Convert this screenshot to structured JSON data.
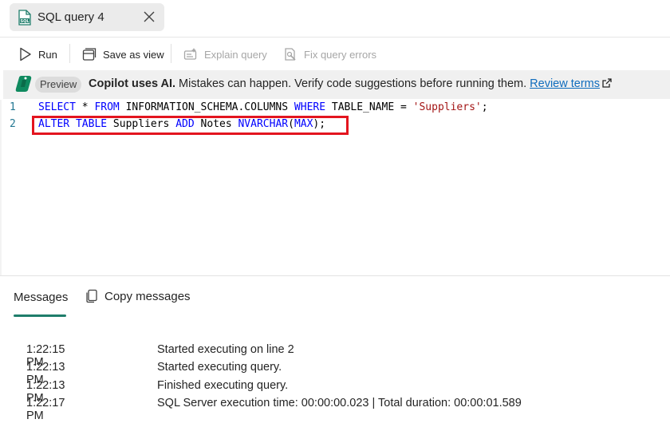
{
  "tab": {
    "title": "SQL query 4",
    "icon": "sql-file-icon"
  },
  "toolbar": {
    "run": "Run",
    "save_as_view": "Save as view",
    "explain_query": "Explain query",
    "fix_query_errors": "Fix query errors"
  },
  "banner": {
    "badge": "Preview",
    "bold": "Copilot uses AI.",
    "message": " Mistakes can happen. Verify code suggestions before running them. ",
    "link": "Review terms"
  },
  "editor": {
    "lines": [
      {
        "number": "1",
        "tokens": [
          {
            "t": "SELECT",
            "c": "kw"
          },
          {
            "t": " * ",
            "c": "tx"
          },
          {
            "t": "FROM",
            "c": "kw"
          },
          {
            "t": " INFORMATION_SCHEMA.COLUMNS ",
            "c": "tx"
          },
          {
            "t": "WHERE",
            "c": "kw"
          },
          {
            "t": " TABLE_NAME = ",
            "c": "tx"
          },
          {
            "t": "'Suppliers'",
            "c": "str"
          },
          {
            "t": ";",
            "c": "tx"
          }
        ]
      },
      {
        "number": "2",
        "tokens": [
          {
            "t": "ALTER",
            "c": "kw"
          },
          {
            "t": " ",
            "c": "tx"
          },
          {
            "t": "TABLE",
            "c": "kw"
          },
          {
            "t": " Suppliers ",
            "c": "tx"
          },
          {
            "t": "ADD",
            "c": "kw"
          },
          {
            "t": " Notes ",
            "c": "tx"
          },
          {
            "t": "NVARCHAR",
            "c": "kw"
          },
          {
            "t": "(",
            "c": "tx"
          },
          {
            "t": "MAX",
            "c": "kw"
          },
          {
            "t": ");",
            "c": "tx"
          }
        ]
      }
    ]
  },
  "messages": {
    "tab_label": "Messages",
    "copy_label": "Copy messages",
    "rows": [
      {
        "time": "1:22:15 PM",
        "text": "Started executing on line 2"
      },
      {
        "time": "1:22:13 PM",
        "text": "Started executing query."
      },
      {
        "time": "1:22:13 PM",
        "text": "Finished executing query."
      },
      {
        "time": "1:22:17 PM",
        "text": "SQL Server execution time: 00:00:00.023 | Total duration: 00:00:01.589"
      }
    ]
  },
  "colors": {
    "accent": "#1f7d6b",
    "highlight_border": "#e3151f",
    "link": "#0f6cbd",
    "keyword": "#0000ff",
    "string": "#a31515"
  }
}
